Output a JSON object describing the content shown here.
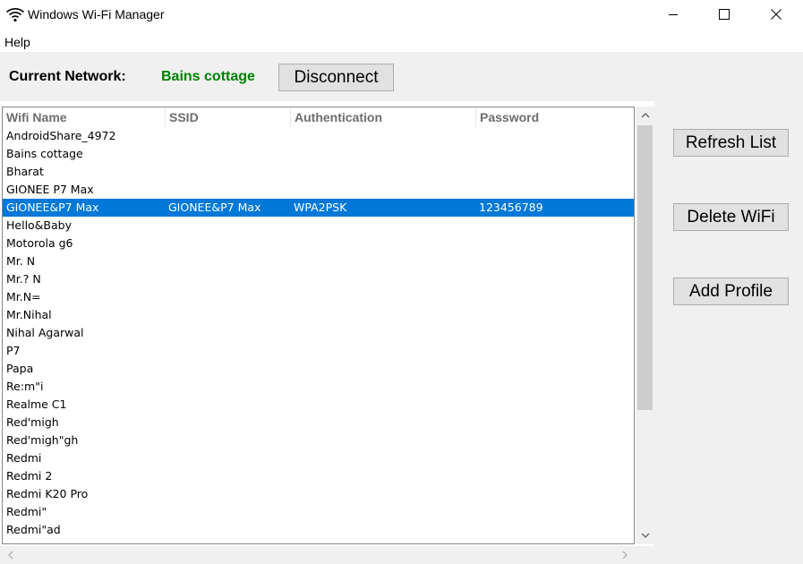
{
  "window": {
    "title": "Windows Wi-Fi Manager",
    "icon": "wifi-icon"
  },
  "menu": {
    "items": [
      "Help"
    ]
  },
  "network": {
    "label": "Current Network:",
    "value": "Bains cottage",
    "value_color": "#008000",
    "disconnect_label": "Disconnect"
  },
  "actions": {
    "refresh_label": "Refresh List",
    "delete_label": "Delete WiFi",
    "add_label": "Add Profile"
  },
  "table": {
    "columns": [
      "Wifi Name",
      "SSID",
      "Authentication",
      "Password"
    ],
    "selected_color": "#0078d7",
    "rows": [
      {
        "name": "AndroidShare_4972",
        "ssid": "",
        "auth": "",
        "password": ""
      },
      {
        "name": "Bains cottage",
        "ssid": "",
        "auth": "",
        "password": ""
      },
      {
        "name": "Bharat",
        "ssid": "",
        "auth": "",
        "password": ""
      },
      {
        "name": "GIONEE P7 Max",
        "ssid": "",
        "auth": "",
        "password": ""
      },
      {
        "name": "GIONEE&P7 Max",
        "ssid": "GIONEE&P7 Max",
        "auth": "WPA2PSK",
        "password": "123456789",
        "selected": true
      },
      {
        "name": "Hello&Baby",
        "ssid": "",
        "auth": "",
        "password": ""
      },
      {
        "name": "Motorola g6",
        "ssid": "",
        "auth": "",
        "password": ""
      },
      {
        "name": "Mr. N",
        "ssid": "",
        "auth": "",
        "password": ""
      },
      {
        "name": "Mr.? N",
        "ssid": "",
        "auth": "",
        "password": ""
      },
      {
        "name": "Mr.N=",
        "ssid": "",
        "auth": "",
        "password": ""
      },
      {
        "name": "Mr.Nihal",
        "ssid": "",
        "auth": "",
        "password": ""
      },
      {
        "name": "Nihal Agarwal",
        "ssid": "",
        "auth": "",
        "password": ""
      },
      {
        "name": "P7",
        "ssid": "",
        "auth": "",
        "password": ""
      },
      {
        "name": "Papa",
        "ssid": "",
        "auth": "",
        "password": ""
      },
      {
        "name": "Re:m\"i",
        "ssid": "",
        "auth": "",
        "password": ""
      },
      {
        "name": "Realme C1",
        "ssid": "",
        "auth": "",
        "password": ""
      },
      {
        "name": "Red'migh",
        "ssid": "",
        "auth": "",
        "password": ""
      },
      {
        "name": "Red'migh\"gh",
        "ssid": "",
        "auth": "",
        "password": ""
      },
      {
        "name": "Redmi",
        "ssid": "",
        "auth": "",
        "password": ""
      },
      {
        "name": "Redmi 2",
        "ssid": "",
        "auth": "",
        "password": ""
      },
      {
        "name": "Redmi K20 Pro",
        "ssid": "",
        "auth": "",
        "password": ""
      },
      {
        "name": "Redmi\"",
        "ssid": "",
        "auth": "",
        "password": ""
      },
      {
        "name": "Redmi\"ad",
        "ssid": "",
        "auth": "",
        "password": ""
      }
    ]
  }
}
